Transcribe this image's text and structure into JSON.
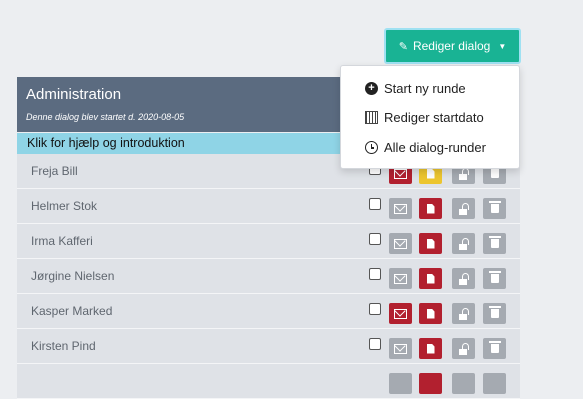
{
  "toolbar": {
    "edit_dialog_label": "Rediger dialog",
    "edit_color": "#19b394"
  },
  "panel": {
    "title": "Administration",
    "subtitle": "Denne dialog blev startet d. 2020-08-05",
    "help_text": "Klik for hjælp og introduktion",
    "header_color": "#5b6b80",
    "help_color": "#8fd4e6"
  },
  "dropdown": {
    "items": [
      {
        "label": "Start ny runde",
        "icon": "plus-circle-icon"
      },
      {
        "label": "Rediger startdato",
        "icon": "calendar-icon"
      },
      {
        "label": "Alle dialog-runder",
        "icon": "clock-icon"
      }
    ]
  },
  "rows": [
    {
      "name": "Freja Bill",
      "mail": "red",
      "doc": "yellow"
    },
    {
      "name": "Helmer Stok",
      "mail": "gray",
      "doc": "red"
    },
    {
      "name": "Irma Kafferi",
      "mail": "gray",
      "doc": "red"
    },
    {
      "name": "Jørgine Nielsen",
      "mail": "gray",
      "doc": "red"
    },
    {
      "name": "Kasper Marked",
      "mail": "red",
      "doc": "red"
    },
    {
      "name": "Kirsten Pind",
      "mail": "gray",
      "doc": "red"
    }
  ],
  "colors": {
    "red": "#b2202f",
    "yellow": "#ecc52e",
    "gray": "#a5aab1"
  }
}
